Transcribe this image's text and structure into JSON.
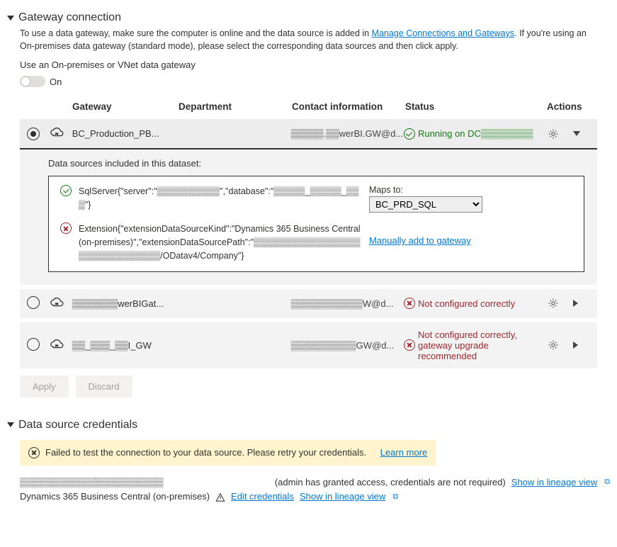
{
  "gatewaySection": {
    "title": "Gateway connection",
    "descBefore": "To use a data gateway, make sure the computer is online and the data source is added in ",
    "descLink": "Manage Connections and Gateways",
    "descAfter": ". If you're using an On-premises data gateway (standard mode), please select the corresponding data sources and then click apply.",
    "toggleLabel": "Use an On-premises or VNet data gateway",
    "toggleState": "On"
  },
  "columns": {
    "gateway": "Gateway",
    "department": "Department",
    "contact": "Contact information",
    "status": "Status",
    "actions": "Actions"
  },
  "gateways": [
    {
      "selected": true,
      "name": "BC_Production_PB...",
      "department": "",
      "contact": "▒▒▒▒▒.▒▒werBI.GW@d...",
      "statusType": "ok",
      "statusText": "Running on DC▒▒▒▒▒▒▒▒",
      "expanded": true
    },
    {
      "selected": false,
      "name": "▒▒▒▒▒▒▒werBIGat...",
      "department": "",
      "contact": "▒▒▒▒▒▒▒▒▒▒▒W@d...",
      "statusType": "bad",
      "statusText": "Not configured correctly",
      "expanded": false
    },
    {
      "selected": false,
      "name": "▒▒_▒▒▒_▒▒I_GW",
      "department": "",
      "contact": "▒▒▒▒▒▒▒▒▒▒GW@d...",
      "statusType": "bad",
      "statusText": "Not configured correctly, gateway upgrade recommended",
      "expanded": false
    }
  ],
  "detail": {
    "title": "Data sources included in this dataset:",
    "ds1": {
      "status": "ok",
      "text": "SqlServer{\"server\":\"▒▒▒▒▒▒▒▒▒▒\",\"database\":\"▒▒▒▒▒_▒▒▒▒▒_▒▒▒\"}",
      "mapsLabel": "Maps to:",
      "mapsValue": "BC_PRD_SQL"
    },
    "ds2": {
      "status": "bad",
      "text": "Extension{\"extensionDataSourceKind\":\"Dynamics 365 Business Central (on-premises)\",\"extensionDataSourcePath\":\"▒▒▒▒▒▒▒▒▒▒▒▒▒▒▒▒▒▒▒▒▒▒▒▒▒▒▒▒▒▒/ODatav4/Company\"}",
      "link": "Manually add to gateway"
    }
  },
  "buttons": {
    "apply": "Apply",
    "discard": "Discard"
  },
  "credSection": {
    "title": "Data source credentials",
    "alertText": "Failed to test the connection to your data source. Please retry your credentials.",
    "alertLink": "Learn more",
    "line1": "▒▒▒▒▒▒▒▒▒▒▒▒▒▒▒▒▒▒▒▒▒▒",
    "line1note": "(admin has granted access, credentials are not required)",
    "showLineage": "Show in lineage view",
    "line2name": "Dynamics 365 Business Central (on-premises)",
    "editCreds": "Edit credentials"
  }
}
